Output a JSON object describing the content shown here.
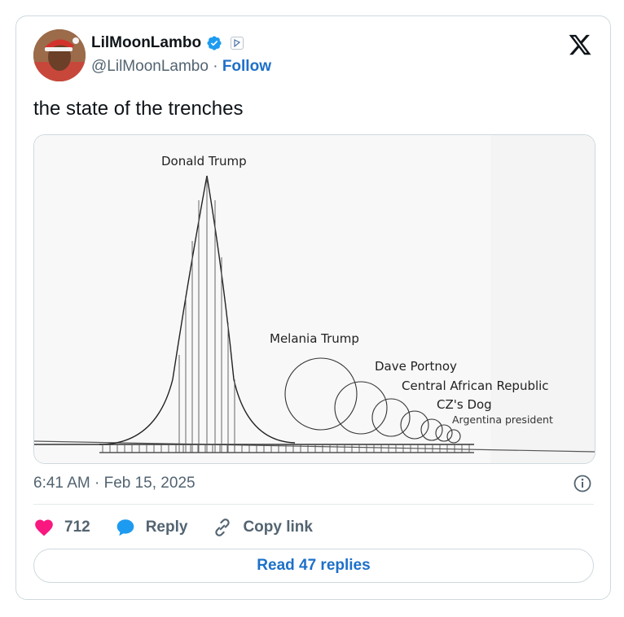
{
  "user": {
    "display_name": "LilMoonLambo",
    "handle": "@LilMoonLambo",
    "separator": "·",
    "follow_label": "Follow"
  },
  "tweet": {
    "text": "the state of the trenches",
    "timestamp": "6:41 AM · Feb 15, 2025"
  },
  "media": {
    "labels": {
      "donald": "Donald Trump",
      "melania": "Melania Trump",
      "dave": "Dave Portnoy",
      "car": "Central African Republic",
      "cz": "CZ's Dog",
      "argentina": "Argentina president"
    }
  },
  "actions": {
    "likes": "712",
    "reply_label": "Reply",
    "copy_label": "Copy link"
  },
  "read_replies_label": "Read 47 replies",
  "colors": {
    "link_blue": "#1d70c9",
    "like_pink": "#f91880",
    "verified_blue": "#1d9bf0",
    "text_gray": "#536471"
  },
  "icons": [
    "verified-icon",
    "affiliate-badge-icon",
    "x-logo-icon",
    "info-icon",
    "heart-icon",
    "reply-icon",
    "link-icon"
  ]
}
